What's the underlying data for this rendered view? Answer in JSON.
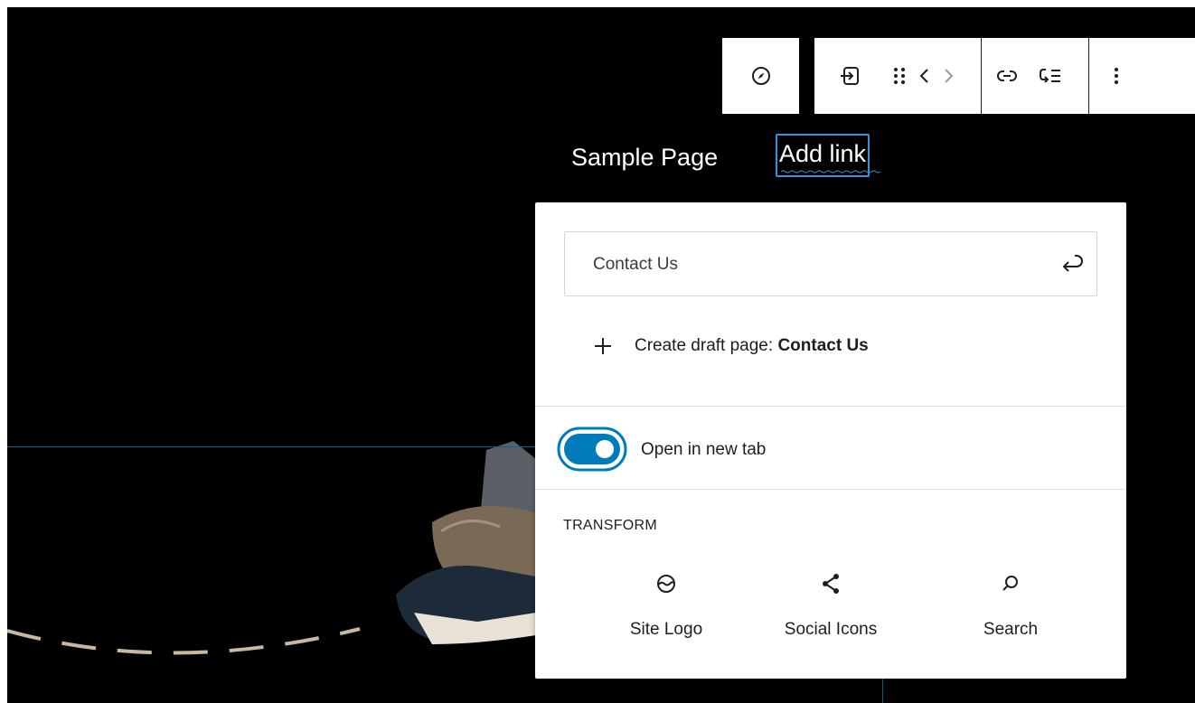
{
  "toolbar": {
    "groups": [
      {
        "icons": [
          "compass-icon"
        ]
      },
      {
        "icons": [
          "submenu-icon",
          "drag-handle-icon",
          "chevron-left-icon",
          "chevron-right-icon"
        ]
      },
      {
        "icons": [
          "link-icon",
          "add-submenu-icon"
        ]
      },
      {
        "icons": [
          "more-options-icon"
        ]
      }
    ]
  },
  "navigation": {
    "items": [
      {
        "label": "Sample Page"
      },
      {
        "label": "Add link"
      }
    ]
  },
  "link_popover": {
    "search": {
      "value": "Contact Us",
      "submit_icon": "enter-icon"
    },
    "create_draft": {
      "prefix": "Create draft page:",
      "page_name": "Contact Us",
      "icon": "plus-icon"
    },
    "open_in_new_tab": {
      "label": "Open in new tab",
      "enabled": true
    },
    "transform": {
      "heading": "TRANSFORM",
      "options": [
        {
          "label": "Site Logo",
          "icon": "site-logo-icon"
        },
        {
          "label": "Social Icons",
          "icon": "share-icon"
        },
        {
          "label": "Search",
          "icon": "search-icon"
        }
      ]
    }
  },
  "colors": {
    "accent": "#007cba",
    "focus": "#3d8fd8",
    "background": "#000000"
  }
}
